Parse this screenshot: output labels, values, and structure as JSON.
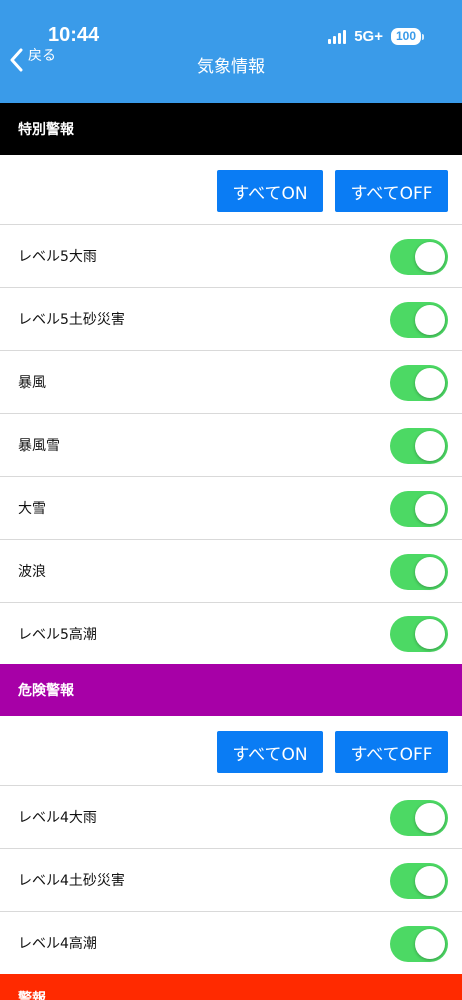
{
  "status": {
    "time": "10:44",
    "network": "5G+",
    "battery": "100"
  },
  "nav": {
    "back_label": "戻る",
    "title": "気象情報"
  },
  "sections": [
    {
      "title": "特別警報",
      "all_on": "すべてON",
      "all_off": "すべてOFF",
      "items": [
        {
          "label": "レベル5大雨",
          "on": true
        },
        {
          "label": "レベル5土砂災害",
          "on": true
        },
        {
          "label": "暴風",
          "on": true
        },
        {
          "label": "暴風雪",
          "on": true
        },
        {
          "label": "大雪",
          "on": true
        },
        {
          "label": "波浪",
          "on": true
        },
        {
          "label": "レベル5高潮",
          "on": true
        }
      ]
    },
    {
      "title": "危険警報",
      "all_on": "すべてON",
      "all_off": "すべてOFF",
      "items": [
        {
          "label": "レベル4大雨",
          "on": true
        },
        {
          "label": "レベル4土砂災害",
          "on": true
        },
        {
          "label": "レベル4高潮",
          "on": true
        }
      ]
    },
    {
      "title": "警報"
    }
  ],
  "colors": {
    "header": "#3a9be9",
    "special": "#000000",
    "danger": "#a700a7",
    "warning": "#ff2a00",
    "button": "#0a7cf4",
    "toggle_on": "#4cd964"
  },
  "icons": {
    "back": "chevron-left-icon",
    "signal": "signal-bars-icon",
    "battery": "battery-icon"
  }
}
